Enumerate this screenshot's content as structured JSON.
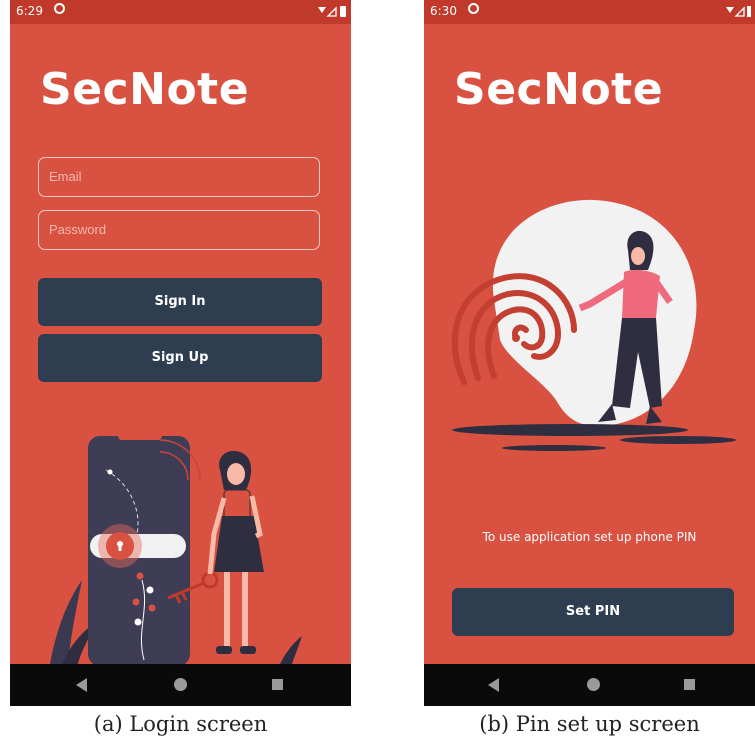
{
  "colors": {
    "app_background": "#d95140",
    "status_bar": "#c0392b",
    "button": "#2e3e50",
    "button_text": "#ffffff",
    "nav_bar": "#0a0a0a",
    "nav_icons": "#9a9a9a",
    "illustration_dark": "#2f2e41",
    "illustration_pink": "#f06a7e",
    "blob": "#f2f2f2"
  },
  "login_screen": {
    "status_bar": {
      "time": "6:29",
      "icons": [
        "at-icon",
        "wifi-icon",
        "signal-icon",
        "battery-icon"
      ]
    },
    "app_title": "SecNote",
    "email_field": {
      "value": "",
      "placeholder": "Email"
    },
    "password_field": {
      "value": "",
      "placeholder": "Password"
    },
    "sign_in_label": "Sign In",
    "sign_up_label": "Sign Up",
    "illustration": "phone-lock-key-woman-illustration",
    "nav_bar": {
      "icons": [
        "back-icon",
        "home-icon",
        "recents-icon"
      ]
    },
    "caption": "(a) Login screen"
  },
  "pin_screen": {
    "status_bar": {
      "time": "6:30",
      "icons": [
        "at-icon",
        "wifi-icon",
        "signal-icon",
        "battery-icon"
      ]
    },
    "app_title": "SecNote",
    "illustration": "fingerprint-woman-illustration",
    "info_text": "To use application set up phone PIN",
    "set_pin_label": "Set PIN",
    "nav_bar": {
      "icons": [
        "back-icon",
        "home-icon",
        "recents-icon"
      ]
    },
    "caption": "(b) Pin set up screen"
  }
}
